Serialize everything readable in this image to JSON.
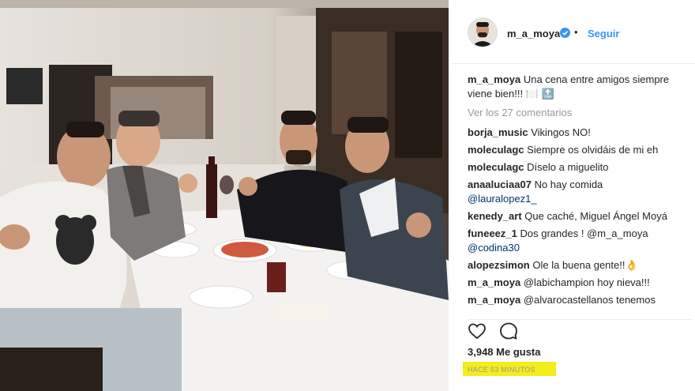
{
  "post": {
    "username": "m_a_moya",
    "follow_label": "Seguir",
    "caption_user": "m_a_moya",
    "caption_text": "Una cena entre amigos siempre viene bien!!! 🍽️ 🔝",
    "view_comments": "Ver los 27 comentarios",
    "likes": "3,948 Me gusta",
    "timestamp": "HACE 53 MINUTOS",
    "verified_color": "#3897f0",
    "highlight_color": "#f5ec1c"
  },
  "comments": [
    {
      "user": "borja_music",
      "text": "Vikingos NO!"
    },
    {
      "user": "moleculagc",
      "text": "Siempre os olvidáis de mi eh"
    },
    {
      "user": "moleculagc",
      "text": "Díselo a miguelito"
    },
    {
      "user": "anaaluciaa07",
      "text": "No hay comida",
      "mention": "@lauralopez1_"
    },
    {
      "user": "kenedy_art",
      "text": "Que caché, Miguel Ángel Moyá"
    },
    {
      "user": "funeeez_1",
      "text": "Dos grandes ! @m_a_moya",
      "mention": "@codina30"
    },
    {
      "user": "alopezsimon",
      "text": "Ole la buena gente!!👌"
    },
    {
      "user": "m_a_moya",
      "text": "@labichampion hoy nieva!!!"
    },
    {
      "user": "m_a_moya",
      "text": "@alvarocastellanos tenemos"
    }
  ],
  "icons": [
    "verified-badge-icon",
    "heart-icon",
    "comment-icon"
  ]
}
